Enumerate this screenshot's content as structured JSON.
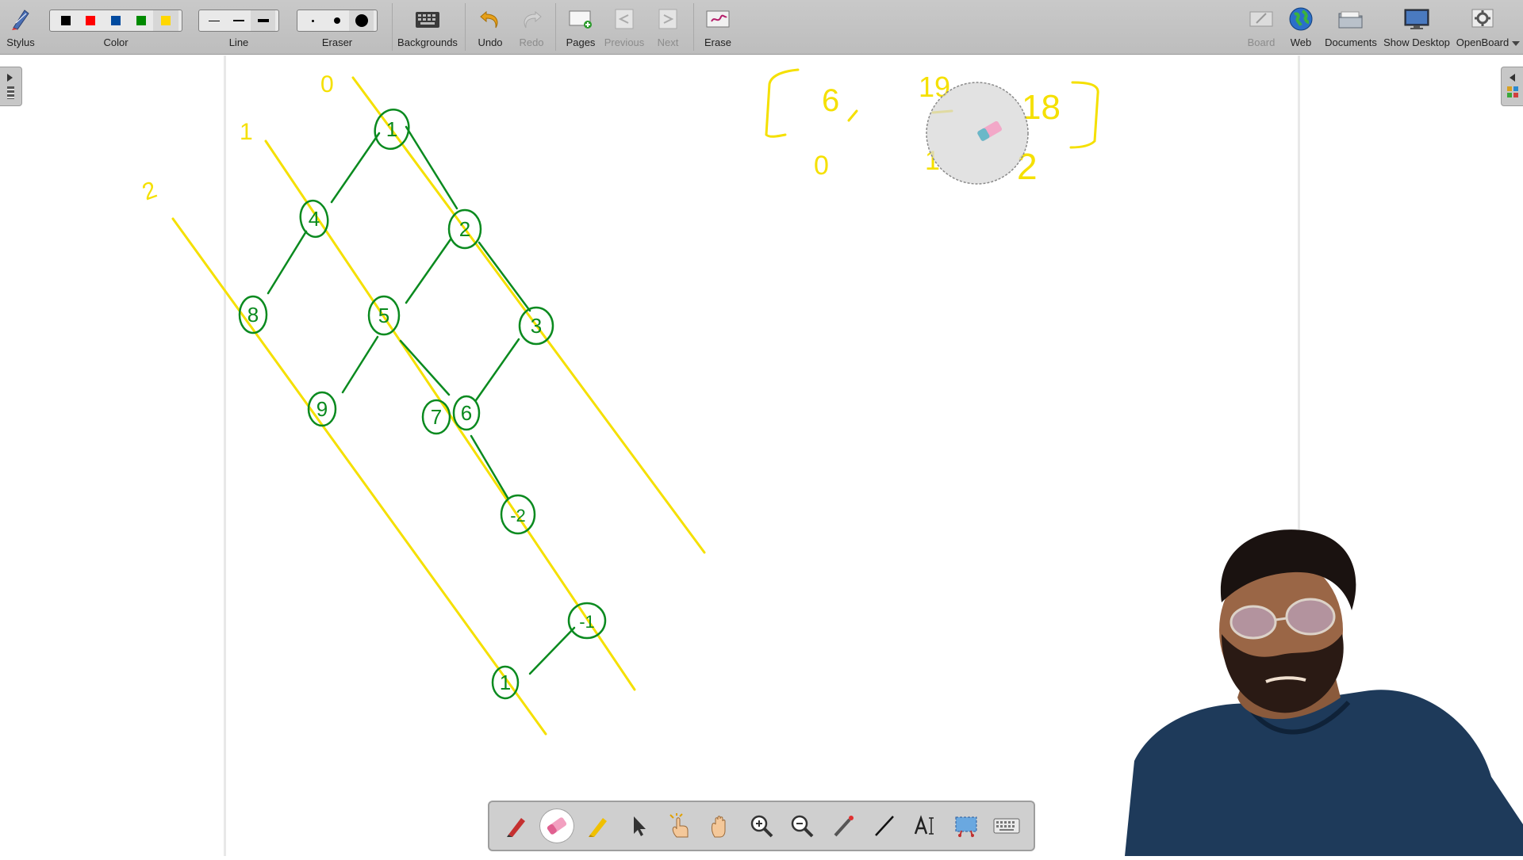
{
  "toolbar": {
    "stylus_label": "Stylus",
    "color_label": "Color",
    "line_label": "Line",
    "eraser_label": "Eraser",
    "backgrounds_label": "Backgrounds",
    "undo_label": "Undo",
    "redo_label": "Redo",
    "pages_label": "Pages",
    "previous_label": "Previous",
    "next_label": "Next",
    "erase_label": "Erase",
    "board_label": "Board",
    "web_label": "Web",
    "documents_label": "Documents",
    "show_desktop_label": "Show Desktop",
    "openboard_label": "OpenBoard",
    "colors": [
      "#000000",
      "#ff0000",
      "#004a9f",
      "#008a00",
      "#ffd700"
    ],
    "selected_color": "#ffd700",
    "line_widths": [
      "thin",
      "medium",
      "thick"
    ],
    "eraser_sizes": [
      "small",
      "medium",
      "large"
    ]
  },
  "board": {
    "ink_green": "#0a8a1f",
    "ink_yellow": "#f5e000",
    "tree_nodes": [
      "1",
      "4",
      "2",
      "8",
      "5",
      "3",
      "9",
      "7",
      "6",
      "-2",
      "-1",
      "1"
    ],
    "level_labels": [
      "0",
      "1",
      "2"
    ],
    "result_values": [
      "6",
      "0",
      "19",
      "1",
      "18",
      "2"
    ]
  },
  "stylus_palette": {
    "tools": [
      "pen",
      "eraser",
      "highlighter",
      "selector",
      "interact",
      "hand",
      "zoom-in",
      "zoom-out",
      "laser-pointer",
      "line",
      "text",
      "capture",
      "virtual-keyboard"
    ],
    "active_tool": "eraser"
  }
}
